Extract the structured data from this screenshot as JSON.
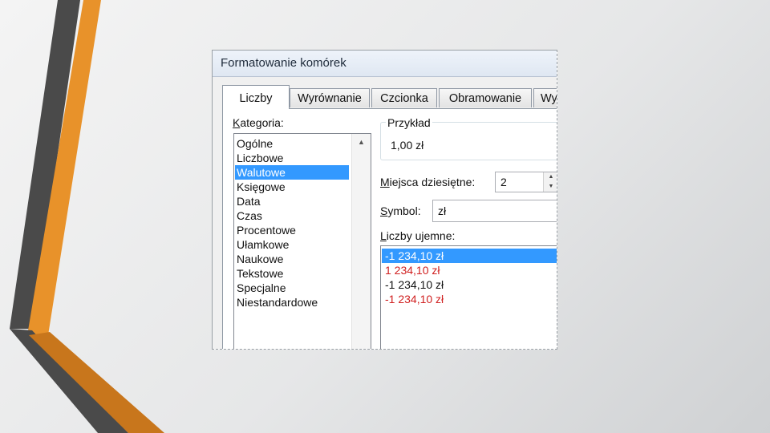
{
  "colors": {
    "accent_orange": "#e8922a",
    "dark_gray": "#4a4a4a",
    "selection_blue": "#3399ff",
    "negative_red": "#d01f1f"
  },
  "dialog": {
    "title": "Formatowanie komórek",
    "tabs": [
      {
        "label": "Liczby",
        "active": true
      },
      {
        "label": "Wyrównanie",
        "active": false
      },
      {
        "label": "Czcionka",
        "active": false
      },
      {
        "label": "Obramowanie",
        "active": false
      },
      {
        "label": "Wy",
        "active": false
      }
    ],
    "category": {
      "label": "Kategoria:",
      "items": [
        "Ogólne",
        "Liczbowe",
        "Walutowe",
        "Księgowe",
        "Data",
        "Czas",
        "Procentowe",
        "Ułamkowe",
        "Naukowe",
        "Tekstowe",
        "Specjalne",
        "Niestandardowe"
      ],
      "selected": "Walutowe"
    },
    "sample": {
      "label": "Przykład",
      "value": "1,00 zł"
    },
    "decimal_places": {
      "label": "Miejsca dziesiętne:",
      "value": "2"
    },
    "symbol": {
      "label": "Symbol:",
      "value": "zł"
    },
    "negative_numbers": {
      "label": "Liczby ujemne:",
      "items": [
        {
          "text": "-1 234,10 zł",
          "color": "#111111",
          "selected": true
        },
        {
          "text": "1 234,10 zł",
          "color": "#d01f1f",
          "selected": false
        },
        {
          "text": "-1 234,10 zł",
          "color": "#111111",
          "selected": false
        },
        {
          "text": "-1 234,10 zł",
          "color": "#d01f1f",
          "selected": false
        }
      ]
    }
  }
}
